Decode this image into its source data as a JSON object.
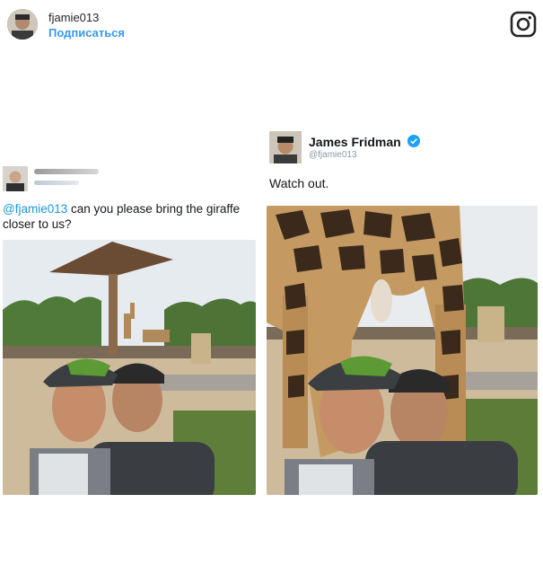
{
  "header": {
    "username": "fjamie013",
    "follow_label": "Подписаться",
    "instagram_icon": "instagram-icon"
  },
  "left_tweet": {
    "mention": "@fjamie013",
    "text": " can you please bring the giraffe closer to us?",
    "photo": "selfie-giraffe-far-photo"
  },
  "right_tweet": {
    "name": "James Fridman",
    "handle": "@fjamie013",
    "text": "Watch out.",
    "photo": "selfie-giraffe-close-photo"
  },
  "colors": {
    "link_blue": "#3897f0",
    "twitter_blue": "#1b95e0",
    "verified_blue": "#1da1f2"
  }
}
